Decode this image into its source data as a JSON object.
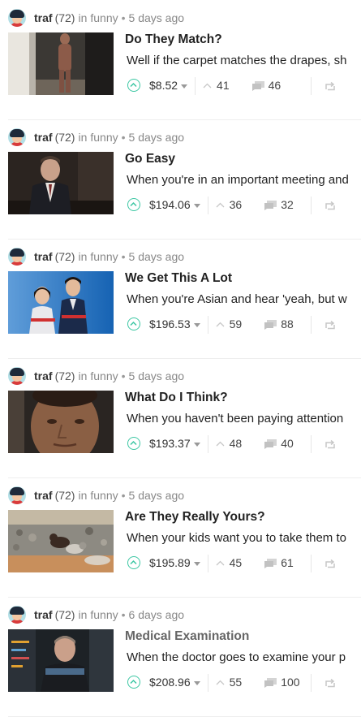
{
  "feed": {
    "posts": [
      {
        "author": "traf",
        "reputation": "(72)",
        "in": "in",
        "category": "funny",
        "time": "5 days ago",
        "title": "Do They Match?",
        "description": "Well if the carpet matches the drapes, sh",
        "payout": "$8.52",
        "votes": "41",
        "comments": "46",
        "visited": false,
        "thumbnail": "hallway-figure"
      },
      {
        "author": "traf",
        "reputation": "(72)",
        "in": "in",
        "category": "funny",
        "time": "5 days ago",
        "title": "Go Easy",
        "description": "When you're in an important meeting and",
        "payout": "$194.06",
        "votes": "36",
        "comments": "32",
        "visited": false,
        "thumbnail": "suited-man"
      },
      {
        "author": "traf",
        "reputation": "(72)",
        "in": "in",
        "category": "funny",
        "time": "5 days ago",
        "title": "We Get This A Lot",
        "description": "When you're Asian and hear 'yeah, but w",
        "payout": "$196.53",
        "votes": "59",
        "comments": "88",
        "visited": false,
        "thumbnail": "two-athletes"
      },
      {
        "author": "traf",
        "reputation": "(72)",
        "in": "in",
        "category": "funny",
        "time": "5 days ago",
        "title": "What Do I Think?",
        "description": "When you haven't been paying attention",
        "payout": "$193.37",
        "votes": "48",
        "comments": "40",
        "visited": false,
        "thumbnail": "face-closeup"
      },
      {
        "author": "traf",
        "reputation": "(72)",
        "in": "in",
        "category": "funny",
        "time": "5 days ago",
        "title": "Are They Really Yours?",
        "description": "When your kids want you to take them to",
        "payout": "$195.89",
        "votes": "45",
        "comments": "61",
        "visited": false,
        "thumbnail": "cats-on-rocks"
      },
      {
        "author": "traf",
        "reputation": "(72)",
        "in": "in",
        "category": "funny",
        "time": "6 days ago",
        "title": "Medical Examination",
        "description": "When the doctor goes to examine your p",
        "payout": "$208.96",
        "votes": "55",
        "comments": "100",
        "visited": true,
        "thumbnail": "starship-doctor"
      }
    ]
  },
  "colors": {
    "accent": "#3cc7a3",
    "title": "#222222",
    "visited_title": "#666666",
    "meta": "#888888"
  },
  "icons": {
    "upvote": "upvote-circle-icon",
    "votes": "chevron-up-icon",
    "comments": "comment-icon",
    "reblog": "reblog-icon",
    "payout_menu": "caret-down-icon"
  }
}
